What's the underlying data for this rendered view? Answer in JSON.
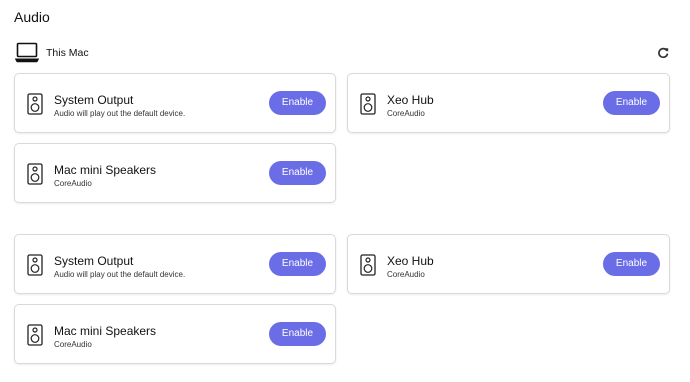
{
  "page": {
    "title": "Audio",
    "device_name": "This Mac"
  },
  "colors": {
    "accent": "#6b6de6",
    "card_border": "#d9d9d9",
    "text": "#111111"
  },
  "icons": {
    "device": "laptop-icon",
    "refresh": "refresh-icon",
    "output": "speaker-icon"
  },
  "groups": [
    {
      "outputs": [
        {
          "name": "System Output",
          "subtitle": "Audio will play out the default device.",
          "button": "Enable"
        },
        {
          "name": "Xeo Hub",
          "subtitle": "CoreAudio",
          "button": "Enable"
        },
        {
          "name": "Mac mini Speakers",
          "subtitle": "CoreAudio",
          "button": "Enable"
        }
      ]
    },
    {
      "outputs": [
        {
          "name": "System Output",
          "subtitle": "Audio will play out the default device.",
          "button": "Enable"
        },
        {
          "name": "Xeo Hub",
          "subtitle": "CoreAudio",
          "button": "Enable"
        },
        {
          "name": "Mac mini Speakers",
          "subtitle": "CoreAudio",
          "button": "Enable"
        }
      ]
    }
  ]
}
